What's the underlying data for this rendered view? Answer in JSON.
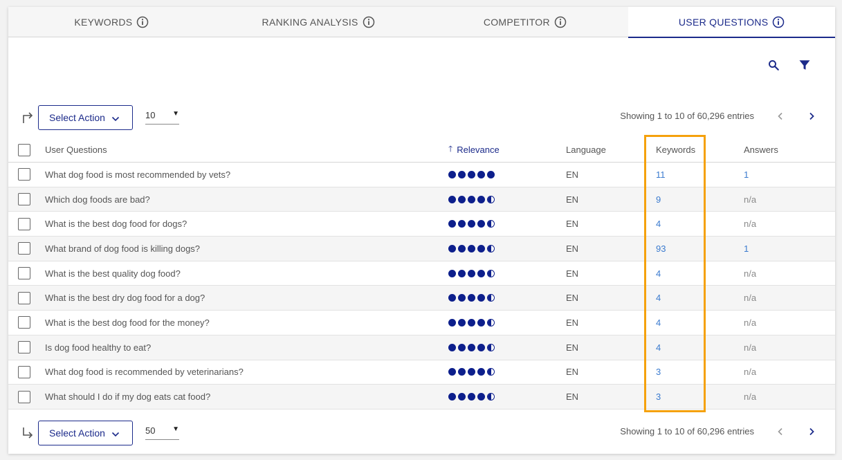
{
  "tabs": [
    {
      "label": "KEYWORDS",
      "active": false
    },
    {
      "label": "RANKING ANALYSIS",
      "active": false
    },
    {
      "label": "COMPETITOR",
      "active": false
    },
    {
      "label": "USER QUESTIONS",
      "active": true
    }
  ],
  "toolbar_top": {
    "select_action_label": "Select Action",
    "page_size": "10",
    "showing": "Showing 1 to 10 of 60,296 entries"
  },
  "toolbar_bottom": {
    "select_action_label": "Select Action",
    "page_size": "50",
    "showing": "Showing 1 to 10 of 60,296 entries"
  },
  "table": {
    "headers": {
      "question": "User Questions",
      "relevance": "Relevance",
      "language": "Language",
      "keywords": "Keywords",
      "answers": "Answers"
    },
    "rows": [
      {
        "question": "What dog food is most recommended by vets?",
        "relevance": 5,
        "language": "EN",
        "keywords": "11",
        "answers": "1"
      },
      {
        "question": "Which dog foods are bad?",
        "relevance": 4.5,
        "language": "EN",
        "keywords": "9",
        "answers": "n/a"
      },
      {
        "question": "What is the best dog food for dogs?",
        "relevance": 4.5,
        "language": "EN",
        "keywords": "4",
        "answers": "n/a"
      },
      {
        "question": "What brand of dog food is killing dogs?",
        "relevance": 4.5,
        "language": "EN",
        "keywords": "93",
        "answers": "1"
      },
      {
        "question": "What is the best quality dog food?",
        "relevance": 4.5,
        "language": "EN",
        "keywords": "4",
        "answers": "n/a"
      },
      {
        "question": "What is the best dry dog food for a dog?",
        "relevance": 4.5,
        "language": "EN",
        "keywords": "4",
        "answers": "n/a"
      },
      {
        "question": "What is the best dog food for the money?",
        "relevance": 4.5,
        "language": "EN",
        "keywords": "4",
        "answers": "n/a"
      },
      {
        "question": "Is dog food healthy to eat?",
        "relevance": 4.5,
        "language": "EN",
        "keywords": "4",
        "answers": "n/a"
      },
      {
        "question": "What dog food is recommended by veterinarians?",
        "relevance": 4.5,
        "language": "EN",
        "keywords": "3",
        "answers": "n/a"
      },
      {
        "question": "What should I do if my dog eats cat food?",
        "relevance": 4.5,
        "language": "EN",
        "keywords": "3",
        "answers": "n/a"
      }
    ]
  },
  "colors": {
    "accent": "#1b2a8a",
    "dots": "#0d1f8c",
    "link": "#3b7bcf",
    "highlight": "#f5a10c"
  }
}
